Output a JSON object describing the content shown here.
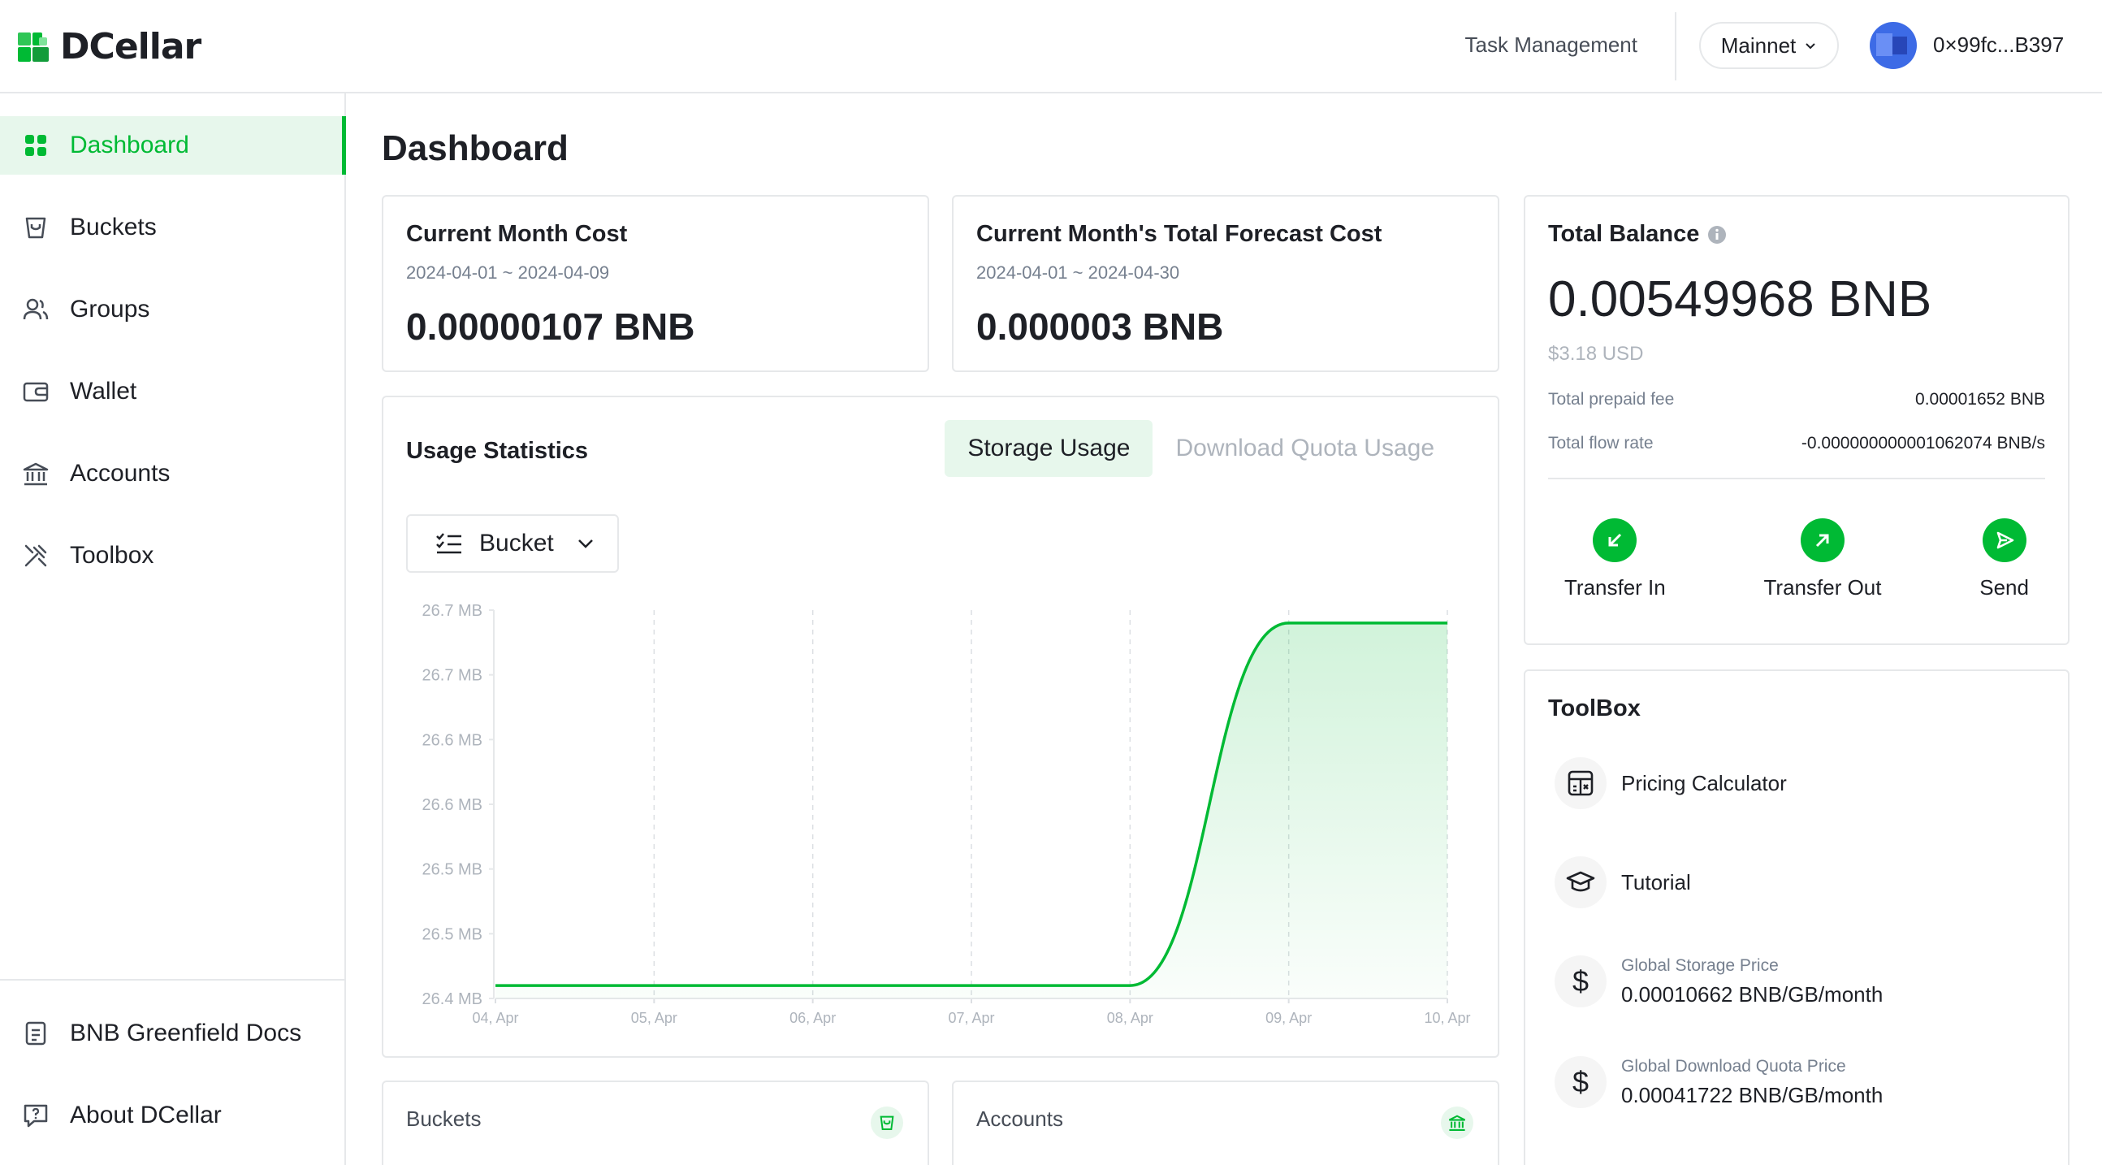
{
  "header": {
    "logo_text": "DCellar",
    "task_management": "Task Management",
    "network": "Mainnet",
    "address": "0×99fc...B397"
  },
  "sidebar": {
    "items": [
      {
        "label": "Dashboard",
        "icon": "dashboard-icon",
        "active": true
      },
      {
        "label": "Buckets",
        "icon": "bucket-icon"
      },
      {
        "label": "Groups",
        "icon": "groups-icon"
      },
      {
        "label": "Wallet",
        "icon": "wallet-icon"
      },
      {
        "label": "Accounts",
        "icon": "bank-icon"
      },
      {
        "label": "Toolbox",
        "icon": "tools-icon"
      }
    ],
    "footer": [
      {
        "label": "BNB Greenfield Docs",
        "icon": "document-icon"
      },
      {
        "label": "About DCellar",
        "icon": "help-chat-icon"
      }
    ]
  },
  "main": {
    "title": "Dashboard",
    "current_cost": {
      "title": "Current Month Cost",
      "range": "2024-04-01 ~ 2024-04-09",
      "value": "0.00000107 BNB"
    },
    "forecast_cost": {
      "title": "Current Month's Total Forecast Cost",
      "range": "2024-04-01 ~ 2024-04-30",
      "value": "0.000003 BNB"
    },
    "usage": {
      "title": "Usage Statistics",
      "tab_storage": "Storage Usage",
      "tab_download": "Download Quota Usage",
      "filter": "Bucket"
    },
    "buckets_card": {
      "title": "Buckets"
    },
    "accounts_card": {
      "title": "Accounts"
    }
  },
  "balance": {
    "title": "Total Balance",
    "amount": "0.00549968",
    "unit": "BNB",
    "usd": "$3.18 USD",
    "prepaid_label": "Total prepaid fee",
    "prepaid_value": "0.00001652 BNB",
    "flow_label": "Total flow rate",
    "flow_value": "-0.000000000001062074 BNB/s",
    "actions": {
      "transfer_in": "Transfer In",
      "transfer_out": "Transfer Out",
      "send": "Send"
    }
  },
  "toolbox": {
    "title": "ToolBox",
    "pricing": "Pricing Calculator",
    "tutorial": "Tutorial",
    "storage_price_label": "Global Storage Price",
    "storage_price_value": "0.00010662 BNB/GB/month",
    "download_price_label": "Global Download Quota Price",
    "download_price_value": "0.00041722 BNB/GB/month"
  },
  "colors": {
    "accent": "#00ba34",
    "accent_bg": "#e7f7ec",
    "border": "#e6e8ea",
    "muted": "#aeb4bc"
  },
  "chart_data": {
    "type": "area",
    "title": "",
    "xlabel": "",
    "ylabel": "",
    "x": [
      "04, Apr",
      "05, Apr",
      "06, Apr",
      "07, Apr",
      "08, Apr",
      "09, Apr",
      "10, Apr"
    ],
    "y_ticks": [
      "26.7 MB",
      "26.7 MB",
      "26.6 MB",
      "26.6 MB",
      "26.5 MB",
      "26.5 MB",
      "26.4 MB"
    ],
    "series": [
      {
        "values": [
          26.41,
          26.41,
          26.41,
          26.41,
          26.41,
          26.69,
          26.69
        ]
      }
    ],
    "ylim": [
      26.4,
      26.7
    ],
    "grid": "vertical dashed"
  }
}
